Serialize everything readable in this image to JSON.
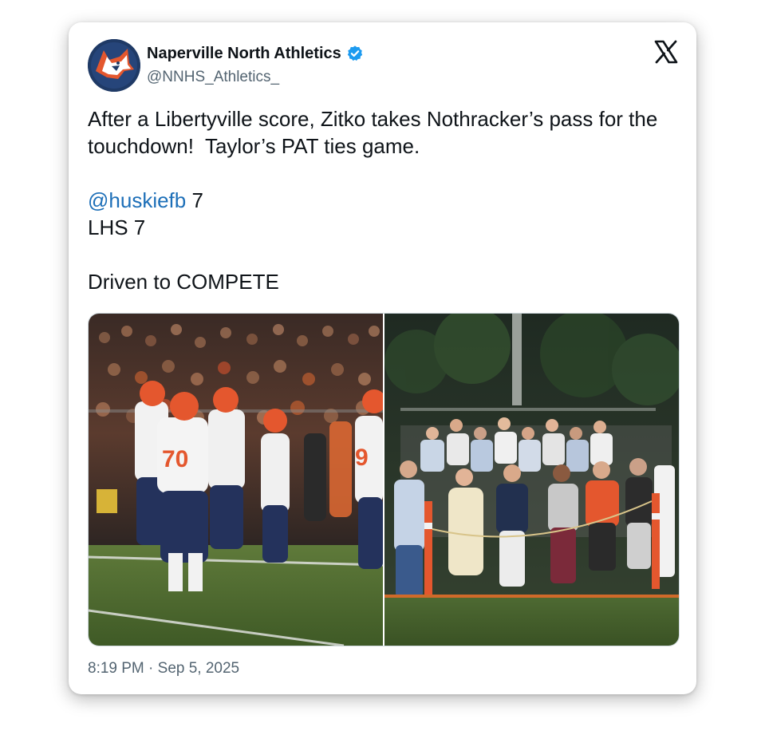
{
  "account": {
    "display_name": "Naperville North Athletics",
    "handle": "@NNHS_Athletics_",
    "verified": true,
    "avatar_icon": "husky-logo-icon"
  },
  "platform_icon": "x-logo-icon",
  "tweet": {
    "line1": "After a Libertyville score, Zitko takes Nothracker’s pass for the touchdown!  Taylor’s PAT ties game.",
    "mention": "@huskiefb",
    "mention_score": " 7",
    "line3": "LHS 7",
    "line4": "Driven to COMPETE"
  },
  "media": {
    "photo1_subject": "football-players-photo",
    "photo1_jerseys": [
      "70",
      "9"
    ],
    "photo2_subject": "student-section-photo"
  },
  "timestamp": "8:19 PM · Sep 5, 2025",
  "colors": {
    "text": "#0f1419",
    "secondary": "#536471",
    "link": "#1d6fb8",
    "verified": "#1d9bf0",
    "jersey_orange": "#e4572e",
    "jersey_navy": "#24325c"
  }
}
